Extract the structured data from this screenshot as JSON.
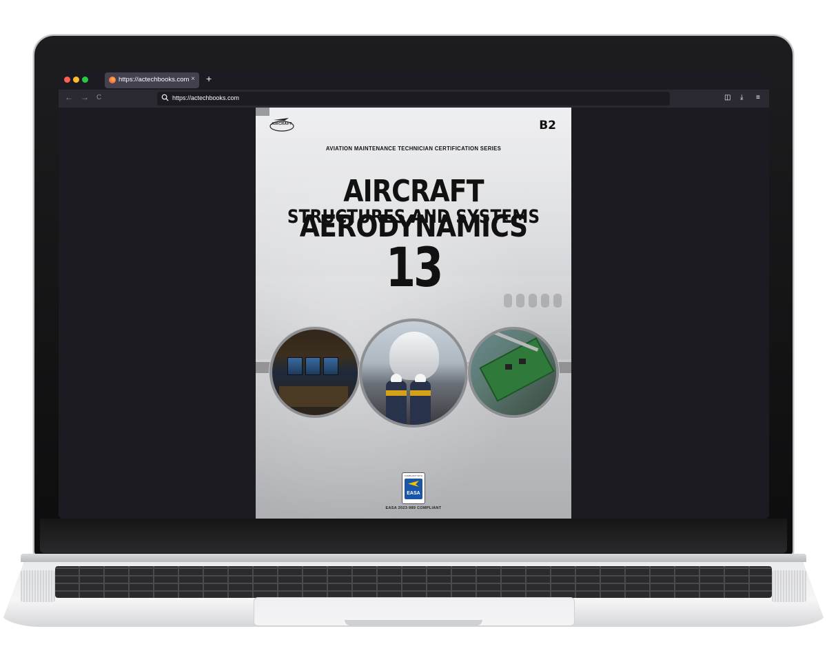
{
  "browser": {
    "tab_title": "https://actechbooks.com",
    "tab_close": "×",
    "new_tab": "+",
    "url": "https://actechbooks.com",
    "nav": {
      "back": "←",
      "forward": "→",
      "reload": "C"
    },
    "toolbar": {
      "pocket": "◫",
      "downloads": "⤓",
      "menu": "≡"
    }
  },
  "cover": {
    "logo_text": "AIRCRAFT",
    "edition": "B2",
    "series": "AVIATION MAINTENANCE TECHNICIAN CERTIFICATION SERIES",
    "title_line1": "AIRCRAFT AERODYNAMICS",
    "title_line2": "STRUCTURES AND SYSTEMS",
    "module_number": "13",
    "easa_badge_top": "COMPLIANT WITH",
    "easa_badge_name": "EASA",
    "easa_caption": "EASA 2023-989 COMPLIANT"
  },
  "colors": {
    "traffic_red": "#ff5f57",
    "traffic_yellow": "#febc2e",
    "traffic_green": "#28c840",
    "browser_bg": "#1c1b22",
    "toolbar_bg": "#2b2a33"
  }
}
